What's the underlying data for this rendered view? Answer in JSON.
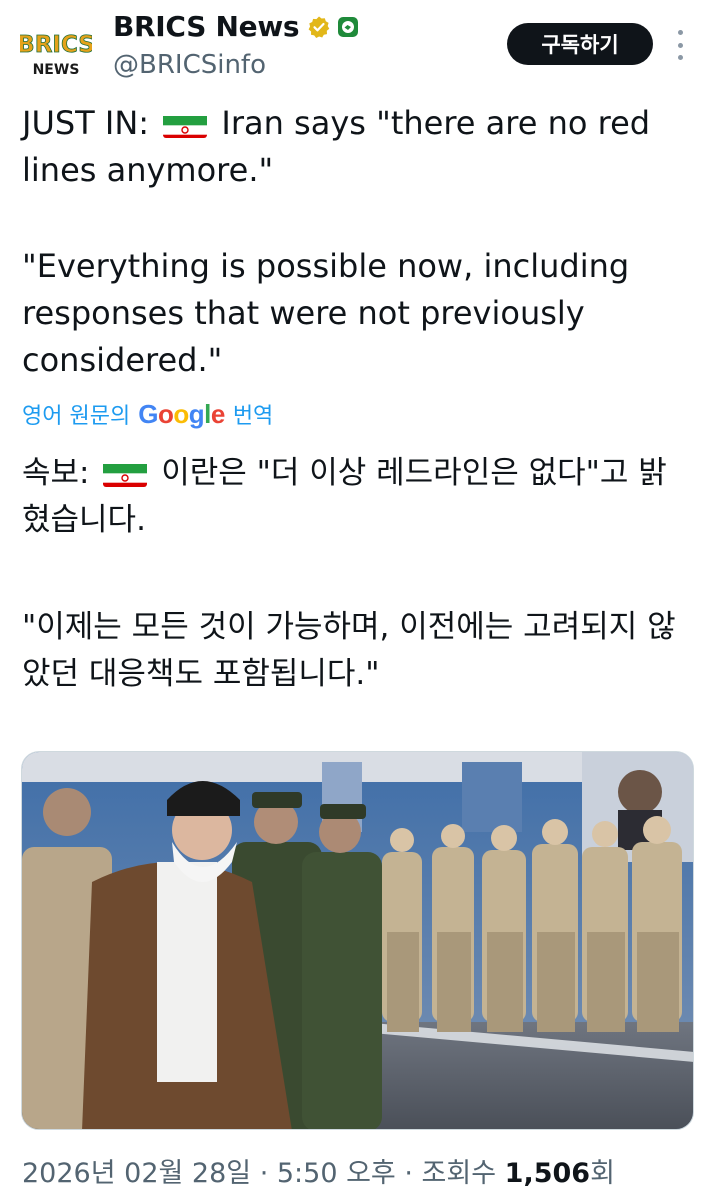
{
  "header": {
    "avatar_line1": "BRICS",
    "avatar_line2": "NEWS",
    "display_name": "BRICS News",
    "handle": "@BRICSinfo",
    "subscribe_label": "구독하기"
  },
  "tweet": {
    "en_line1_prefix": "JUST IN:",
    "en_line1_suffix": "Iran says \"there are no red lines anymore.\"",
    "en_quote": "\"Everything is possible now, including responses that were not previously considered.\"",
    "translate_prefix": "영어 원문의",
    "translate_brand": "Google",
    "translate_suffix": "번역",
    "ko_line1_prefix": "속보:",
    "ko_line1_suffix": "이란은 \"더 이상 레드라인은 없다\"고 밝혔습니다.",
    "ko_quote": "\"이제는 모든 것이 가능하며, 이전에는 고려되지 않았던 대응책도 포함됩니다.\""
  },
  "meta": {
    "date": "2026년 02월 28일",
    "sep1": " · ",
    "time": "5:50 오후",
    "sep2": " · ",
    "views_label": "조회수",
    "views_count": "1,506",
    "views_suffix": "회"
  },
  "colors": {
    "link": "#1d9bf0",
    "secondary": "#536471",
    "verified_gold": "#e2b719"
  },
  "icons": [
    "verified-badge-icon",
    "affiliate-badge-icon",
    "more-options-icon",
    "iran-flag-icon"
  ]
}
